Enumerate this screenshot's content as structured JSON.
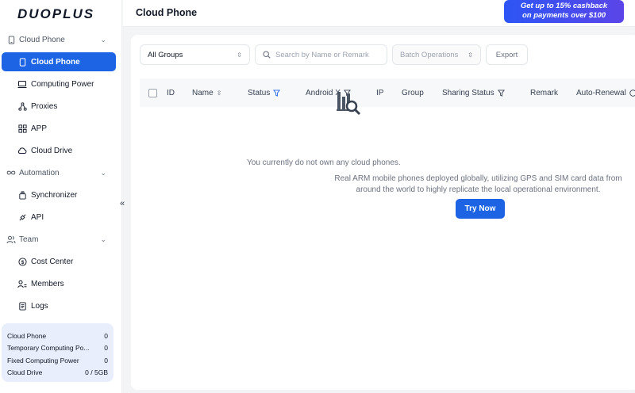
{
  "logo": "DUOPLUS",
  "nav": {
    "cloud_phone_section": "Cloud Phone",
    "items_cloud": [
      "Cloud Phone",
      "Computing Power",
      "Proxies",
      "APP",
      "Cloud Drive"
    ],
    "automation_section": "Automation",
    "items_automation": [
      "Synchronizer",
      "API"
    ],
    "team_section": "Team",
    "items_team": [
      "Cost Center",
      "Members",
      "Logs"
    ]
  },
  "quota": [
    {
      "label": "Cloud Phone",
      "value": "0"
    },
    {
      "label": "Temporary Computing Po...",
      "value": "0"
    },
    {
      "label": "Fixed Computing Power",
      "value": "0"
    },
    {
      "label": "Cloud Drive",
      "value": "0 / 5GB"
    }
  ],
  "header": {
    "title": "Cloud Phone",
    "promo_line1": "Get up to 15% cashback",
    "promo_line2": "on payments over $100"
  },
  "toolbar": {
    "group_select": "All Groups",
    "search_placeholder": "Search by Name or Remark",
    "batch_label": "Batch Operations",
    "export_label": "Export"
  },
  "table": {
    "columns": [
      "ID",
      "Name",
      "Status",
      "Android X",
      "IP",
      "Group",
      "Sharing Status",
      "Remark",
      "Auto-Renewal"
    ]
  },
  "empty": {
    "line1": "You currently do not own any cloud phones.",
    "line2": "Real ARM mobile phones deployed globally, utilizing GPS and SIM card data from around the world to highly replicate the local operational environment.",
    "button": "Try Now"
  },
  "colors": {
    "accent": "#1d64e5",
    "promo_start": "#2d55f5",
    "promo_end": "#5b45e8"
  }
}
